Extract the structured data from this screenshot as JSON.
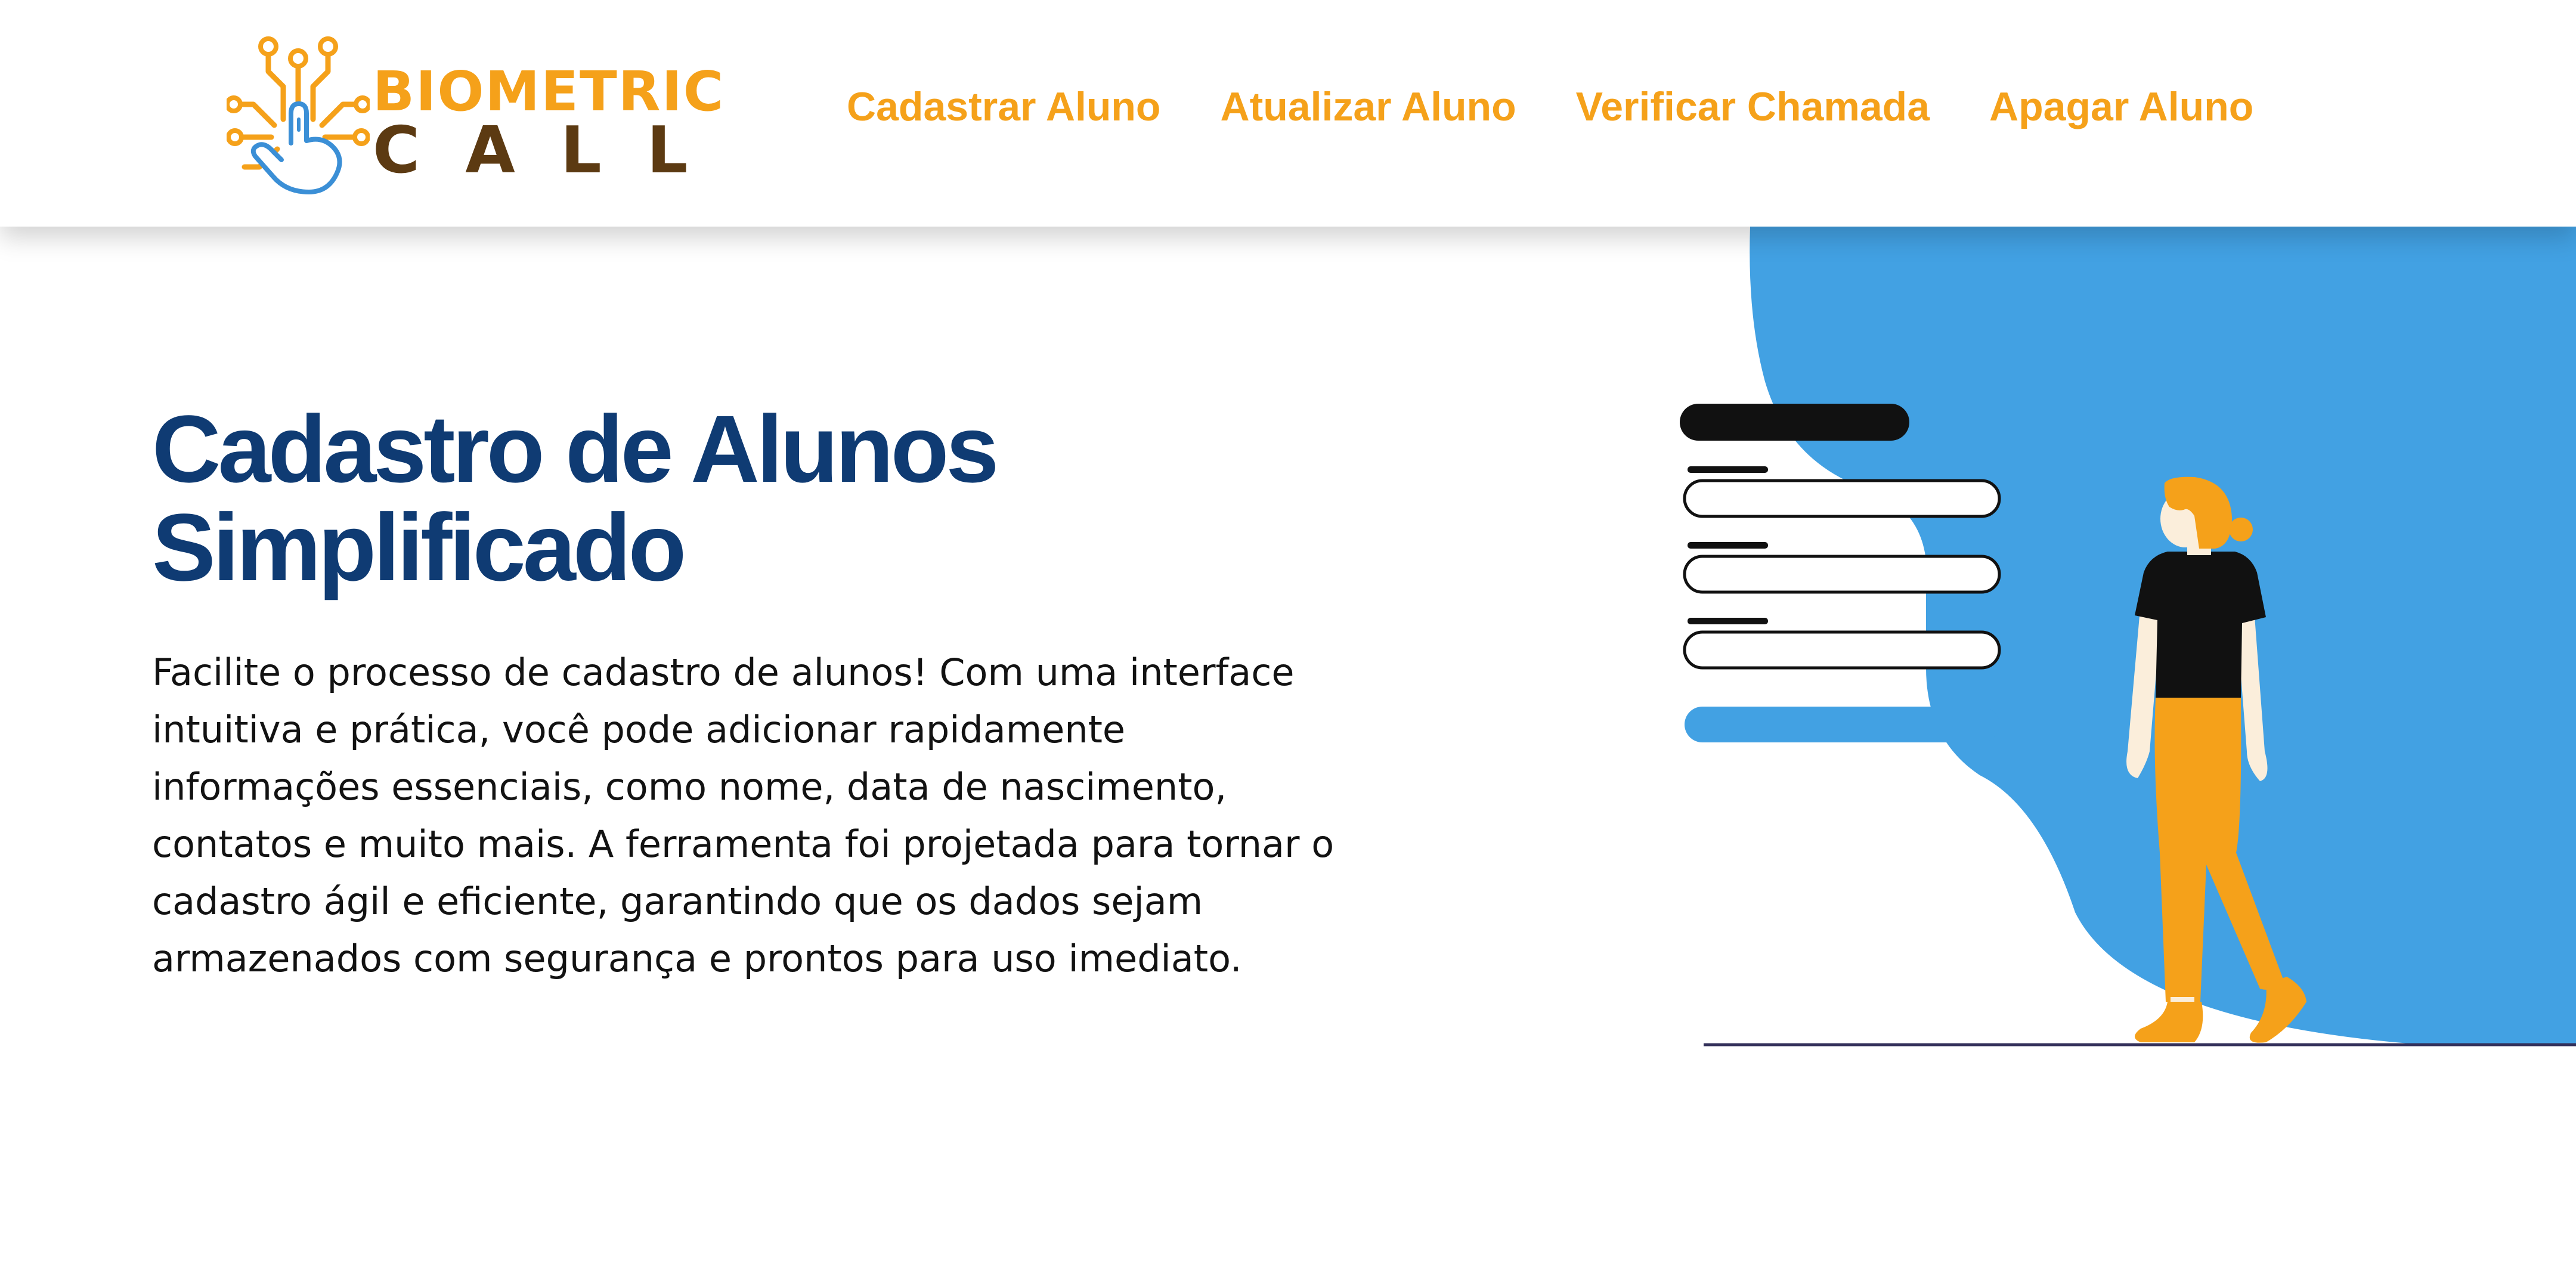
{
  "brand": {
    "name_top": "BIOMETRIC",
    "name_bottom": "CALL",
    "logo_icon": "fingerprint-touch-circuit-icon"
  },
  "nav": {
    "items": [
      {
        "label": "Cadastrar Aluno"
      },
      {
        "label": "Atualizar Aluno"
      },
      {
        "label": "Verificar Chamada"
      },
      {
        "label": "Apagar Aluno"
      }
    ]
  },
  "hero": {
    "title_line1": "Cadastro de Alunos",
    "title_line2": "Simplificado",
    "description": "Facilite o processo de cadastro de alunos! Com uma interface intuitiva e prática, você pode adicionar rapidamente informações essenciais, como nome, data de nascimento, contatos e muito mais. A ferramenta foi projetada para tornar o cadastro ágil e eficiente, garantindo que os dados sejam armazenados com segurança e prontos para uso imediato."
  },
  "illustration": {
    "icon": "person-with-form-illustration"
  },
  "colors": {
    "accent_orange": "#f5a11a",
    "brand_brown": "#5c3a12",
    "title_blue": "#0f3b73",
    "blob_blue": "#42a1e3",
    "text_dark": "#121212"
  }
}
